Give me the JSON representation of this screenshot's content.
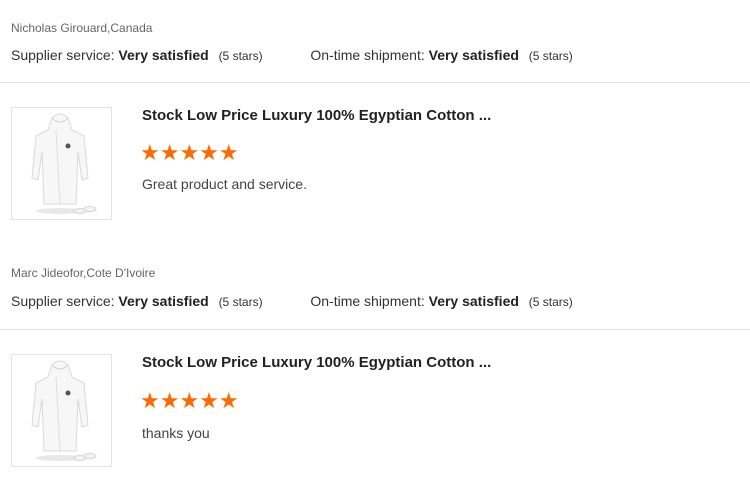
{
  "reviews": [
    {
      "reviewer": "Nicholas Girouard,Canada",
      "supplier_label": "Supplier service:",
      "supplier_value": "Very satisfied",
      "supplier_stars": "(5 stars)",
      "shipment_label": "On-time shipment:",
      "shipment_value": "Very satisfied",
      "shipment_stars": "(5 stars)",
      "product_title": "Stock Low Price Luxury 100% Egyptian Cotton ...",
      "rating": 5,
      "stars": "★★★★★",
      "comment": "Great product and service."
    },
    {
      "reviewer": "Marc Jideofor,Cote D'Ivoire",
      "supplier_label": "Supplier service:",
      "supplier_value": "Very satisfied",
      "supplier_stars": "(5 stars)",
      "shipment_label": "On-time shipment:",
      "shipment_value": "Very satisfied",
      "shipment_stars": "(5 stars)",
      "product_title": "Stock Low Price Luxury 100% Egyptian Cotton ...",
      "rating": 5,
      "stars": "★★★★★",
      "comment": "thanks you"
    }
  ],
  "colors": {
    "star": "#ff6a00",
    "divider": "#e2e2e2"
  },
  "icons": {
    "product_thumbnail": "white-bathrobe-image"
  }
}
